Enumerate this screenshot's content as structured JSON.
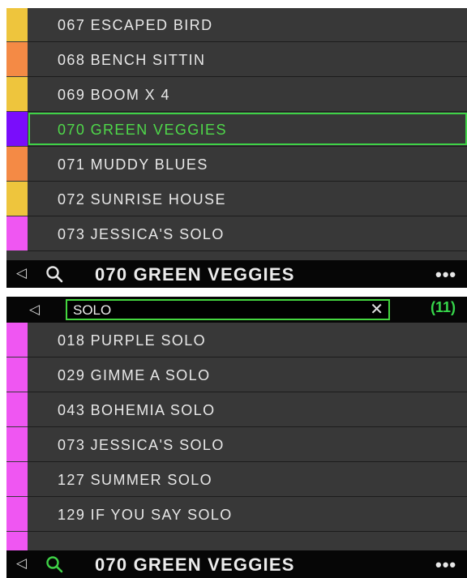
{
  "colors": {
    "yellow": "#eec53d",
    "orange": "#f48a45",
    "purple": "#7a0dfb",
    "magenta": "#ef56f2",
    "accent_green": "#3fd247"
  },
  "top_panel": {
    "items": [
      {
        "label": "067 ESCAPED BIRD",
        "color": "#eec53d"
      },
      {
        "label": "068 BENCH SITTIN",
        "color": "#f48a45"
      },
      {
        "label": "069 BOOM X 4",
        "color": "#eec53d"
      },
      {
        "label": "070 GREEN VEGGIES",
        "color": "#7a0dfb",
        "selected": true
      },
      {
        "label": "071 MUDDY BLUES",
        "color": "#f48a45"
      },
      {
        "label": "072 SUNRISE HOUSE",
        "color": "#eec53d"
      },
      {
        "label": "073 JESSICA'S SOLO",
        "color": "#ef56f2"
      }
    ],
    "bottom_bar": {
      "back_icon": "back-triangle-icon",
      "search_icon": "search-icon",
      "title": "070 GREEN VEGGIES",
      "more": "•••"
    }
  },
  "bottom_panel": {
    "search": {
      "query": "SOLO",
      "clear_icon": "close-icon",
      "count": "(11)"
    },
    "items": [
      {
        "label": "018 PURPLE SOLO",
        "color": "#ef56f2"
      },
      {
        "label": "029 GIMME A SOLO",
        "color": "#ef56f2"
      },
      {
        "label": "043 BOHEMIA SOLO",
        "color": "#ef56f2"
      },
      {
        "label": "073 JESSICA'S SOLO",
        "color": "#ef56f2"
      },
      {
        "label": "127 SUMMER SOLO",
        "color": "#ef56f2"
      },
      {
        "label": "129 IF YOU SAY SOLO",
        "color": "#ef56f2"
      }
    ],
    "bottom_bar": {
      "back_icon": "back-triangle-icon",
      "search_icon": "search-icon",
      "title": "070 GREEN VEGGIES",
      "more": "•••"
    }
  }
}
